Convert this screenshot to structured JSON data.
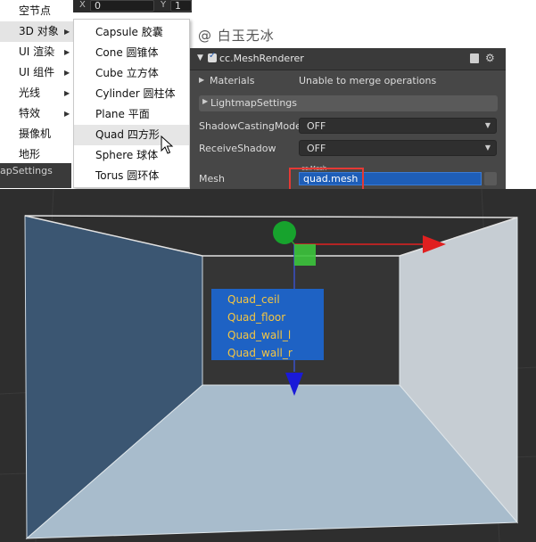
{
  "transform_fields": {
    "x_label": "X",
    "x_value": "0",
    "y_label": "Y",
    "y_value": "1"
  },
  "main_menu": {
    "items": [
      {
        "label": "空节点",
        "has_submenu": false
      },
      {
        "label": "3D 对象",
        "has_submenu": true
      },
      {
        "label": "UI 渲染",
        "has_submenu": true
      },
      {
        "label": "UI 组件",
        "has_submenu": true
      },
      {
        "label": "光线",
        "has_submenu": true
      },
      {
        "label": "特效",
        "has_submenu": true
      },
      {
        "label": "摄像机",
        "has_submenu": false
      },
      {
        "label": "地形",
        "has_submenu": false
      }
    ]
  },
  "submenu_3d": {
    "items": [
      "Capsule 胶囊",
      "Cone 圆锥体",
      "Cube 立方体",
      "Cylinder 圆柱体",
      "Plane 平面",
      "Quad 四方形",
      "Sphere 球体",
      "Torus 圆环体"
    ],
    "hovered": "Quad 四方形"
  },
  "background_panel_fragment": "apSettings",
  "watermark": "@ 白玉无冰",
  "inspector": {
    "component_title": "cc.MeshRenderer",
    "enabled": true,
    "materials_label": "Materials",
    "materials_value": "Unable to merge operations",
    "lightmap_label": "LightmapSettings",
    "shadow_casting_label": "ShadowCastingMode",
    "shadow_casting_value": "OFF",
    "receive_shadow_label": "ReceiveShadow",
    "receive_shadow_value": "OFF",
    "mesh_label": "Mesh",
    "mesh_tag": "cc.Mesh",
    "mesh_value": "quad.mesh"
  },
  "scene_objects": [
    "Quad_ceil",
    "Quad_floor",
    "Quad_wall_l",
    "Quad_wall_r"
  ],
  "colors": {
    "selection_blue": "#1e62c4",
    "object_label_yellow": "#f4c542",
    "highlight_red": "#e53935",
    "gizmo_x": "#e02020",
    "gizmo_y": "#2ea02e",
    "gizmo_z": "#1a1ad8"
  }
}
